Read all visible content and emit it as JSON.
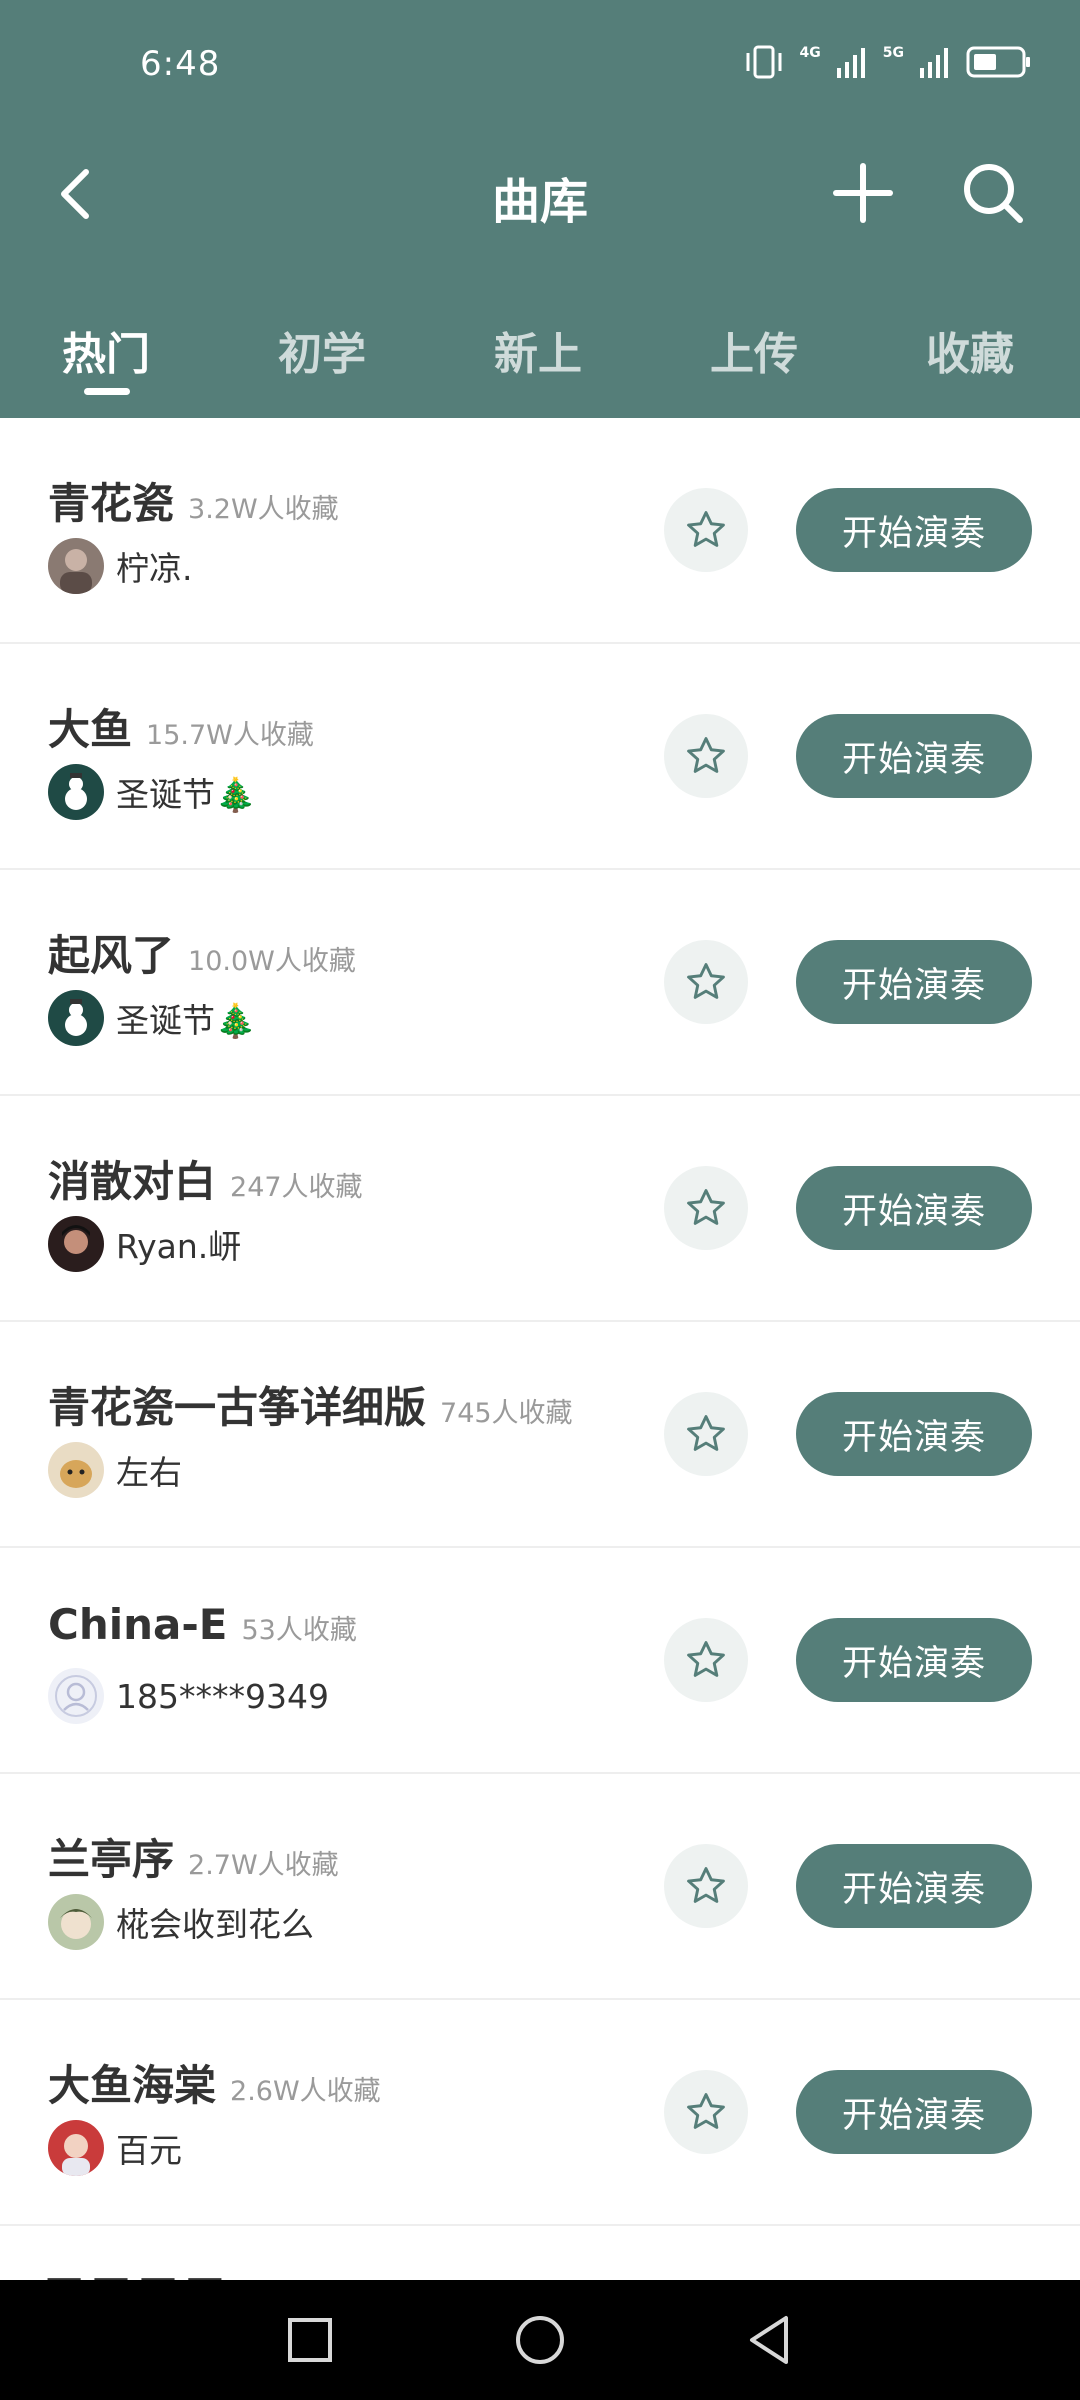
{
  "status_bar": {
    "time": "6:48",
    "sig1": "4G",
    "sig2": "5G"
  },
  "header": {
    "title": "曲库",
    "tabs": [
      "热门",
      "初学",
      "新上",
      "上传",
      "收藏"
    ]
  },
  "songs": [
    {
      "title": "青花瓷",
      "favs": "3.2W人收藏",
      "author": "柠凉.",
      "play": "开始演奏"
    },
    {
      "title": "大鱼",
      "favs": "15.7W人收藏",
      "author": "圣诞节🎄",
      "play": "开始演奏"
    },
    {
      "title": "起风了",
      "favs": "10.0W人收藏",
      "author": "圣诞节🎄",
      "play": "开始演奏"
    },
    {
      "title": "消散对白",
      "favs": "247人收藏",
      "author": "Ryan.岍",
      "play": "开始演奏"
    },
    {
      "title": "青花瓷一古筝详细版",
      "favs": "745人收藏",
      "author": "左右",
      "play": "开始演奏"
    },
    {
      "title": "China-E",
      "favs": "53人收藏",
      "author": "185****9349",
      "play": "开始演奏"
    },
    {
      "title": "兰亭序",
      "favs": "2.7W人收藏",
      "author": "椛会收到花么",
      "play": "开始演奏"
    },
    {
      "title": "大鱼海棠",
      "favs": "2.6W人收藏",
      "author": "百元",
      "play": "开始演奏"
    }
  ],
  "colors": {
    "accent": "#557e79",
    "star_bg": "#eef2f1"
  }
}
